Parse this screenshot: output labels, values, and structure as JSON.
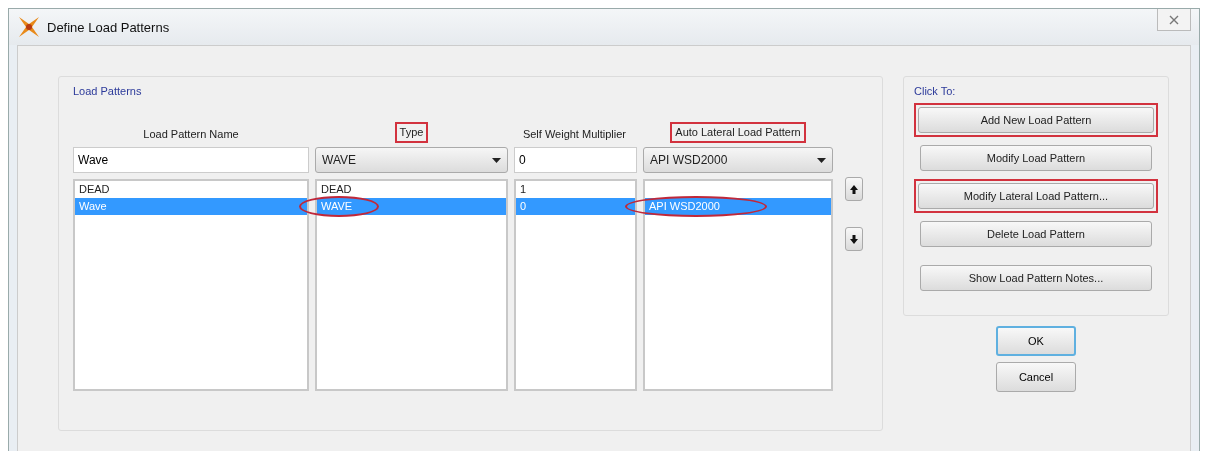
{
  "window": {
    "title": "Define Load Patterns"
  },
  "load_patterns": {
    "title": "Load Patterns",
    "columns": [
      {
        "header": "Load Pattern Name",
        "annotated": false
      },
      {
        "header": "Type",
        "annotated": true
      },
      {
        "header": "Self Weight Multiplier",
        "annotated": false
      },
      {
        "header": "Auto Lateral Load Pattern",
        "annotated": true
      }
    ],
    "inputs": [
      {
        "kind": "text",
        "value": "Wave"
      },
      {
        "kind": "dropdown",
        "value": "WAVE"
      },
      {
        "kind": "text",
        "value": "0"
      },
      {
        "kind": "dropdown",
        "value": "API WSD2000"
      }
    ],
    "rows": [
      {
        "selected": false,
        "cells": [
          {
            "text": "DEAD",
            "circled": false
          },
          {
            "text": "DEAD",
            "circled": false
          },
          {
            "text": "1",
            "circled": false
          },
          {
            "circled": false
          }
        ]
      },
      {
        "selected": true,
        "cells": [
          {
            "text": "Wave",
            "circled": false
          },
          {
            "text": "WAVE",
            "circled": true
          },
          {
            "text": "0",
            "circled": false
          },
          {
            "text": "API WSD2000",
            "circled": true
          }
        ]
      }
    ]
  },
  "click_to": {
    "title": "Click To:",
    "buttons": [
      {
        "label": "Add New Load Pattern",
        "annotated": true
      },
      {
        "label": "Modify Load Pattern",
        "annotated": false
      },
      {
        "label": "Modify Lateral Load Pattern...",
        "annotated": true
      },
      {
        "label": "Delete Load Pattern",
        "annotated": false
      }
    ],
    "notes_button": {
      "label": "Show Load Pattern Notes...",
      "annotated": false
    }
  },
  "dialog_buttons": [
    {
      "label": "OK",
      "focused": true
    },
    {
      "label": "Cancel",
      "focused": false
    }
  ]
}
